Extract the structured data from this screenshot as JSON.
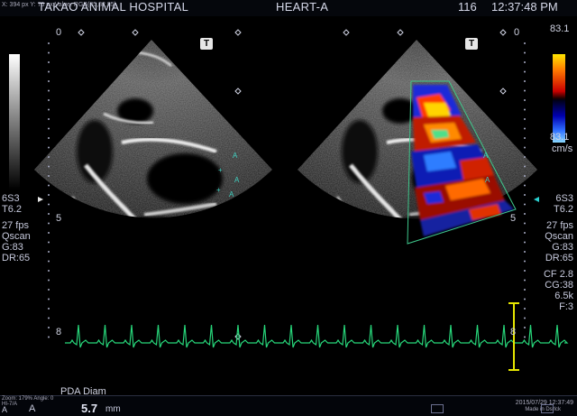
{
  "header": {
    "small_info": "X: 394 px  Y: 75 px  Value: RGB(85,82,85)",
    "hospital": "TAKAO ANIMAL HOSPITAL",
    "probe_preset": "HEART-A",
    "frame_number": "116",
    "time": "12:37:48 PM"
  },
  "left_panel": {
    "depth_top": "0",
    "depth_mid": "5",
    "depth_bot": "8",
    "t_badge": "T"
  },
  "right_panel": {
    "depth_top": "0",
    "depth_mid": "5",
    "depth_bot": "8",
    "t_badge": "T"
  },
  "color_scale": {
    "top_value": "83.1",
    "bottom_value": "83.1",
    "unit": "cm/s"
  },
  "params_left": {
    "probe": "6S3",
    "tis": "T6.2",
    "fps": "27 fps",
    "mode": "Qscan",
    "gain": "G:83",
    "dr": "DR:65"
  },
  "params_right": {
    "probe": "6S3",
    "tis": "T6.2",
    "fps": "27 fps",
    "mode": "Qscan",
    "gain": "G:83",
    "dr": "DR:65",
    "cf": "CF 2.8",
    "cg": "CG:38",
    "freq": "6.5k",
    "filter": "F:3"
  },
  "measurement": {
    "label": "PDA Diam",
    "marker": "A",
    "value": "5.7",
    "unit": "mm"
  },
  "footer": {
    "zoom": "Zoom: 179%  Angle: 0",
    "sub": "HI-7/A",
    "marker_letter": "A",
    "date": "2015/07/29 12:37:49",
    "origin": "Made in Dsrlck"
  },
  "colors": {
    "ecg": "#27d67a",
    "caliper": "#e6e600",
    "roi_outline": "#3fc88c"
  }
}
